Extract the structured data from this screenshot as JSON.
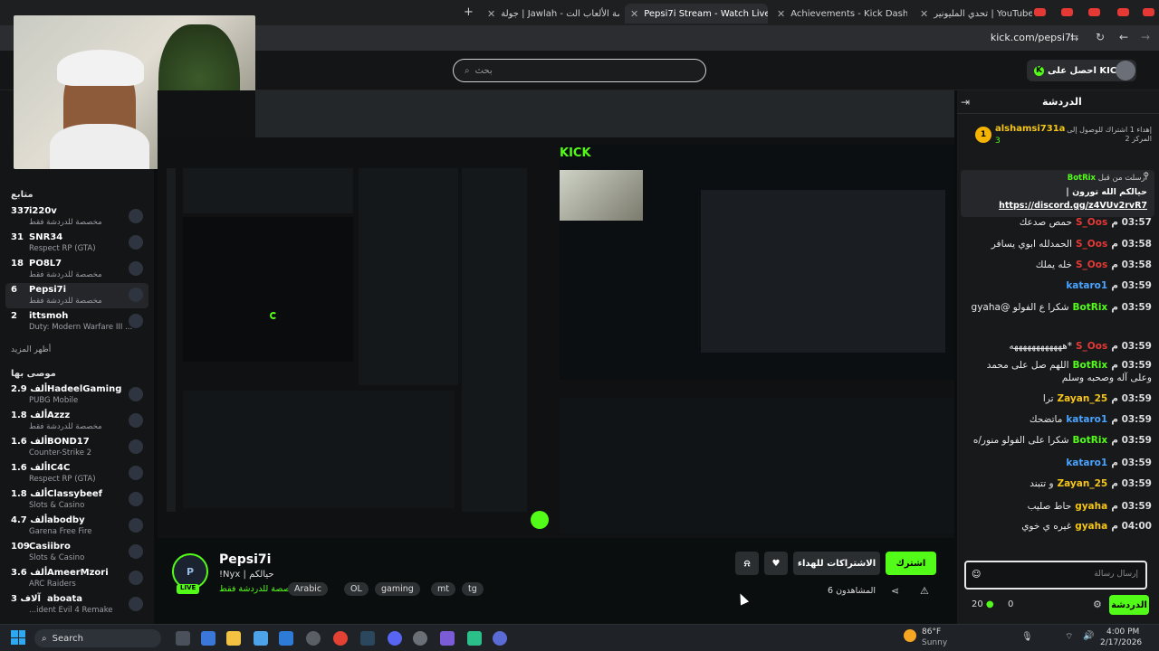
{
  "browser": {
    "tabs": [
      {
        "label": "تحدي المليونير | YouTube - Challenge"
      },
      {
        "label": "Achievements - Kick Dashboard"
      },
      {
        "label": "Pepsi7i Stream - Watch Live on"
      },
      {
        "label": "جولة | Jawlah - منصة الألعاب الت"
      }
    ],
    "url": "kick.com/pepsi7i"
  },
  "header": {
    "search_placeholder": "بحث",
    "get_kicks": "احصل على KICKs"
  },
  "sidebar": {
    "following_title": "متابع",
    "following": [
      {
        "name": "i220v",
        "viewers": "337",
        "sub": "مخصصة للدردشة فقط"
      },
      {
        "name": "SNR34",
        "viewers": "31",
        "sub": "Respect RP (GTA)"
      },
      {
        "name": "PO8L7",
        "viewers": "18",
        "sub": "مخصصة للدردشة فقط"
      },
      {
        "name": "Pepsi7i",
        "viewers": "6",
        "sub": "مخصصة للدردشة فقط"
      },
      {
        "name": "ittsmoh",
        "viewers": "2",
        "sub": "Duty: Modern Warfare III ..."
      }
    ],
    "show_more": "أظهر المزيد",
    "recommended_title": "موصى بها",
    "recommended": [
      {
        "name": "HadeelGaming",
        "viewers": "2.9 ألف",
        "sub": "PUBG Mobile"
      },
      {
        "name": "Azzz",
        "viewers": "1.8 ألف",
        "sub": "مخصصة للدردشة فقط"
      },
      {
        "name": "BOND17",
        "viewers": "1.6 ألف",
        "sub": "Counter-Strike 2"
      },
      {
        "name": "IC4C",
        "viewers": "1.6 ألف",
        "sub": "Respect RP (GTA)"
      },
      {
        "name": "Classybeef",
        "viewers": "1.8 ألف",
        "sub": "Slots & Casino"
      },
      {
        "name": "abodby",
        "viewers": "4.7 ألف",
        "sub": "Garena Free Fire"
      },
      {
        "name": "Casiibro",
        "viewers": "109",
        "sub": "Slots & Casino"
      },
      {
        "name": "AmeerMzori",
        "viewers": "3.6 ألف",
        "sub": "ARC Raiders"
      },
      {
        "name": "aboata",
        "viewers": "3 آلاف",
        "sub": "...ident Evil 4 Remake"
      }
    ]
  },
  "stream": {
    "name": "Pepsi7i",
    "title": "!Nyx | حيالكم",
    "category": "مخصصة للدردشة فقط",
    "live": "LIVE",
    "tags": [
      "Arabic",
      "OL",
      "gaming",
      "mt",
      "tg"
    ],
    "follow": "اشترك",
    "gift": "الاشتراكات للهداء",
    "viewers": "المشاهدون 6"
  },
  "chat": {
    "title": "الدردشة",
    "leader": {
      "name": "alshamsi731a",
      "count": "3",
      "note": "إهداء 1 اشتراك للوصول إلى المركز 2"
    },
    "pinned": {
      "user": "BotRix",
      "label": "أرسلت من قبل",
      "text": "حيالكم الله تورون |",
      "link": "https://discord.gg/z4VUv2rvR7"
    },
    "messages": [
      {
        "time": "03:57 م",
        "user": "S_Oos",
        "text": "حمص صدعك",
        "color": "#e53935"
      },
      {
        "time": "03:58 م",
        "user": "S_Oos",
        "text": "الحمدلله ابوي يسافر",
        "color": "#e53935"
      },
      {
        "time": "03:58 م",
        "user": "S_Oos",
        "text": "خله يملك",
        "color": "#e53935"
      },
      {
        "time": "03:59 م",
        "user": "kataro1",
        "text": "",
        "color": "#4aa3ff"
      },
      {
        "time": "03:59 م",
        "user": "BotRix",
        "text": "شكرا ع الفولو @gyaha",
        "color": "#53fc18"
      },
      {
        "time": "03:59 م",
        "user": "S_Oos",
        "text": "*ههههههههههههه",
        "color": "#e53935"
      },
      {
        "time": "03:59 م",
        "user": "BotRix",
        "text": "اللهم صل على محمد وعلى آله وصحبه وسلم",
        "color": "#53fc18"
      },
      {
        "time": "03:59 م",
        "user": "Zayan_25",
        "text": "ترا",
        "color": "#f5c518"
      },
      {
        "time": "03:59 م",
        "user": "kataro1",
        "text": "ماتضحك",
        "color": "#4aa3ff"
      },
      {
        "time": "03:59 م",
        "user": "BotRix",
        "text": "شكرا على الفولو منور/ه",
        "color": "#53fc18"
      },
      {
        "time": "03:59 م",
        "user": "kataro1",
        "text": "",
        "color": "#4aa3ff"
      },
      {
        "time": "03:59 م",
        "user": "Zayan_25",
        "text": "و تتبند",
        "color": "#f5c518"
      },
      {
        "time": "03:59 م",
        "user": "gyaha",
        "text": "حاط صليب",
        "color": "#f5c518"
      },
      {
        "time": "04:00 م",
        "user": "gyaha",
        "text": "غيره ي خوي",
        "color": "#f5c518"
      }
    ],
    "input_placeholder": "إرسال رسالة",
    "points": "20",
    "zero": "0",
    "send": "الدردشة"
  },
  "taskbar": {
    "search": "Search",
    "weather_temp": "86°F",
    "weather_desc": "Sunny",
    "time": "4:00 PM",
    "date": "2/17/2026"
  },
  "colors": {
    "accent": "#53fc18",
    "live": "#53fc18",
    "danger": "#e53935"
  }
}
